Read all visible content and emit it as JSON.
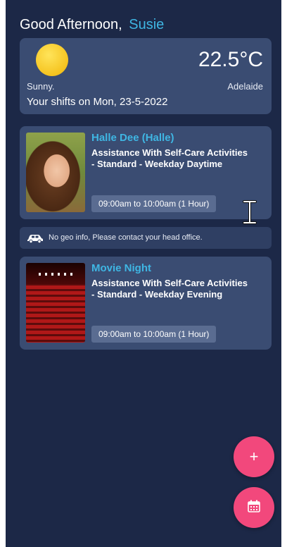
{
  "header": {
    "greeting": "Good Afternoon,",
    "user_name": "Susie"
  },
  "weather": {
    "icon": "sun-icon",
    "temperature": "22.5°C",
    "condition": "Sunny.",
    "city": "Adelaide",
    "shifts_label": "Your shifts on Mon, 23-5-2022"
  },
  "shifts": [
    {
      "client": "Halle Dee (Halle)",
      "service_line1": "Assistance With Self-Care Activities",
      "service_line2": "- Standard - Weekday Daytime",
      "time": "09:00am to 10:00am (1 Hour)"
    },
    {
      "client": "Movie Night",
      "service_line1": "Assistance With Self-Care Activities",
      "service_line2": "- Standard - Weekday Evening",
      "time": "09:00am to 10:00am (1 Hour)"
    }
  ],
  "geo_notice": {
    "icon": "car-icon",
    "text": "No geo info, Please contact your head office."
  },
  "fab": {
    "add_icon": "plus-icon",
    "add_symbol": "+",
    "calendar_icon": "calendar-icon"
  },
  "colors": {
    "background": "#1c2847",
    "card": "#3a4c72",
    "accent": "#3fb6e3",
    "fab": "#f2487c",
    "sun": "#f5c420"
  }
}
